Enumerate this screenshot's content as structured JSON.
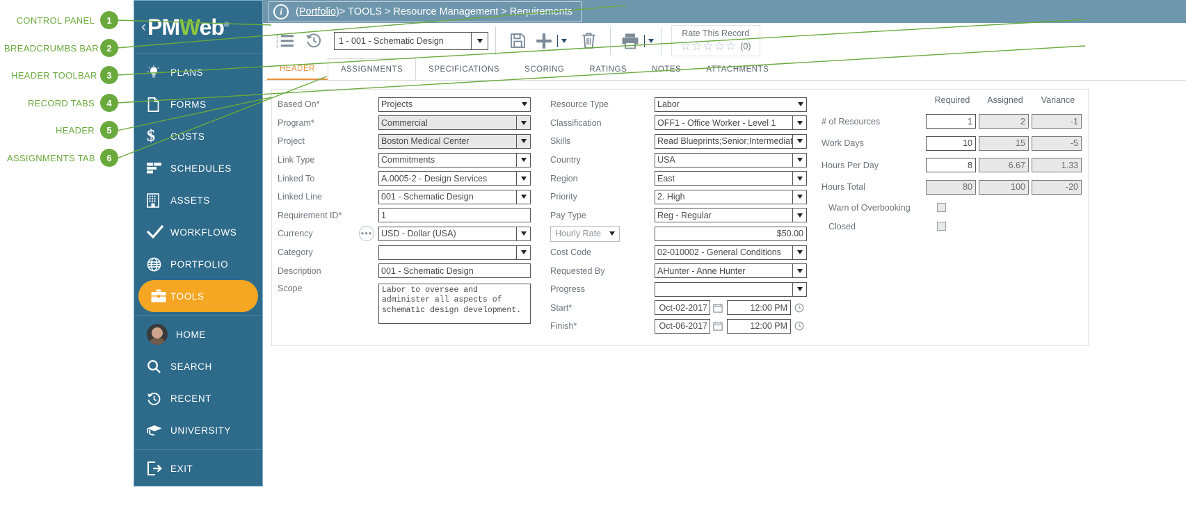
{
  "callouts": [
    {
      "num": "1",
      "label": "CONTROL PANEL"
    },
    {
      "num": "2",
      "label": "BREADCRUMBS BAR"
    },
    {
      "num": "3",
      "label": "HEADER TOOLBAR"
    },
    {
      "num": "4",
      "label": "RECORD TABS"
    },
    {
      "num": "5",
      "label": "HEADER"
    },
    {
      "num": "6",
      "label": "ASSIGNMENTS TAB"
    }
  ],
  "sidebar": {
    "logo": {
      "part1": "PM",
      "part2": "W",
      "part3": "eb",
      "registered": "®"
    },
    "collapse_chevron": "‹",
    "group1": [
      {
        "label": "PLANS",
        "icon": "lightbulb-icon"
      },
      {
        "label": "FORMS",
        "icon": "document-icon"
      },
      {
        "label": "COSTS",
        "icon": "dollar-icon"
      },
      {
        "label": "SCHEDULES",
        "icon": "schedule-icon"
      },
      {
        "label": "ASSETS",
        "icon": "building-icon"
      },
      {
        "label": "WORKFLOWS",
        "icon": "checkmark-icon"
      },
      {
        "label": "PORTFOLIO",
        "icon": "globe-icon"
      },
      {
        "label": "TOOLS",
        "icon": "toolbox-icon",
        "active": true
      }
    ],
    "group2": [
      {
        "label": "HOME",
        "icon": "avatar-icon"
      },
      {
        "label": "SEARCH",
        "icon": "search-icon"
      },
      {
        "label": "RECENT",
        "icon": "history-icon"
      },
      {
        "label": "UNIVERSITY",
        "icon": "graduation-cap-icon"
      }
    ],
    "group3": [
      {
        "label": "EXIT",
        "icon": "exit-icon"
      }
    ]
  },
  "breadcrumb": {
    "info_icon": "i",
    "portfolio": "(Portfolio)",
    "trail": " > TOOLS > Resource Management > Requirements"
  },
  "toolbar": {
    "list_icon": "numbered-list-icon",
    "history_icon": "history-icon",
    "record_select": "1 -  001 - Schematic Design",
    "save_icon": "save-icon",
    "add_icon": "add-icon",
    "delete_icon": "trash-icon",
    "print_icon": "print-icon",
    "rate_title": "Rate This Record",
    "stars": [
      "☆",
      "☆",
      "☆",
      "☆",
      "☆"
    ],
    "rate_count": "(0)"
  },
  "tabs": [
    {
      "label": "HEADER",
      "active": true
    },
    {
      "label": "ASSIGNMENTS",
      "boxed": true
    },
    {
      "label": "SPECIFICATIONS"
    },
    {
      "label": "SCORING"
    },
    {
      "label": "RATINGS"
    },
    {
      "label": "NOTES"
    },
    {
      "label": "ATTACHMENTS"
    }
  ],
  "form": {
    "left": [
      {
        "label": "Based On*",
        "value": "Projects",
        "type": "plain-select"
      },
      {
        "label": "Program*",
        "value": "Commercial",
        "type": "select-ro"
      },
      {
        "label": "Project",
        "value": "Boston Medical Center",
        "type": "select-ro"
      },
      {
        "label": "Link Type",
        "value": "Commitments",
        "type": "select"
      },
      {
        "label": "Linked To",
        "value": "A.0005-2 - Design Services",
        "type": "select"
      },
      {
        "label": "Linked Line",
        "value": "001 - Schematic Design",
        "type": "select"
      },
      {
        "label": "Requirement ID*",
        "value": "1",
        "type": "text"
      },
      {
        "label": "Currency",
        "value": "USD - Dollar (USA)",
        "type": "select",
        "prefix_icon": "ellipsis-icon"
      },
      {
        "label": "Category",
        "value": "",
        "type": "select"
      },
      {
        "label": "Description",
        "value": "001 - Schematic Design",
        "type": "text"
      },
      {
        "label": "Scope",
        "value": "Labor to oversee and administer all aspects of schematic design development.",
        "type": "textarea"
      }
    ],
    "middle": [
      {
        "label": "Resource Type",
        "value": "Labor",
        "type": "plain-select"
      },
      {
        "label": "Classification",
        "value": "OFF1 - Office Worker - Level 1",
        "type": "select"
      },
      {
        "label": "Skills",
        "value": "Read Blueprints;Senior;Intermediate",
        "type": "select"
      },
      {
        "label": "Country",
        "value": "USA",
        "type": "select"
      },
      {
        "label": "Region",
        "value": "East",
        "type": "select"
      },
      {
        "label": "Priority",
        "value": "2. High",
        "type": "select"
      },
      {
        "label": "Pay Type",
        "value": "Reg - Regular",
        "type": "select"
      },
      {
        "label": "Hourly Rate",
        "value": "$50.00",
        "type": "rate"
      },
      {
        "label": "Cost Code",
        "value": "02-010002 - General Conditions",
        "type": "select"
      },
      {
        "label": "Requested By",
        "value": "AHunter - Anne Hunter",
        "type": "select"
      },
      {
        "label": "Progress",
        "value": "",
        "type": "select"
      },
      {
        "label": "Start*",
        "date": "Oct-02-2017",
        "time": "12:00 PM",
        "type": "datetime"
      },
      {
        "label": "Finish*",
        "date": "Oct-06-2017",
        "time": "12:00 PM",
        "type": "datetime"
      }
    ],
    "grid": {
      "columns": [
        "Required",
        "Assigned",
        "Variance"
      ],
      "rows": [
        {
          "label": "# of Resources",
          "required": "1",
          "assigned": "2",
          "variance": "-1",
          "required_ro": false
        },
        {
          "label": "Work Days",
          "required": "10",
          "assigned": "15",
          "variance": "-5",
          "required_ro": false
        },
        {
          "label": "Hours Per Day",
          "required": "8",
          "assigned": "6.67",
          "variance": "1.33",
          "required_ro": false
        },
        {
          "label": "Hours Total",
          "required": "80",
          "assigned": "100",
          "variance": "-20",
          "required_ro": true
        }
      ],
      "checkboxes": [
        {
          "label": "Warn of Overbooking",
          "checked": false
        },
        {
          "label": "Closed",
          "checked": false
        }
      ]
    }
  },
  "colors": {
    "sidebar_bg": "#2e6a8a",
    "accent_orange": "#f5a623",
    "tab_active": "#e8913a",
    "callout_green": "#6aaa3c",
    "breadcrumb_bg": "#6e96ad",
    "logo_green": "#8cc63f"
  }
}
